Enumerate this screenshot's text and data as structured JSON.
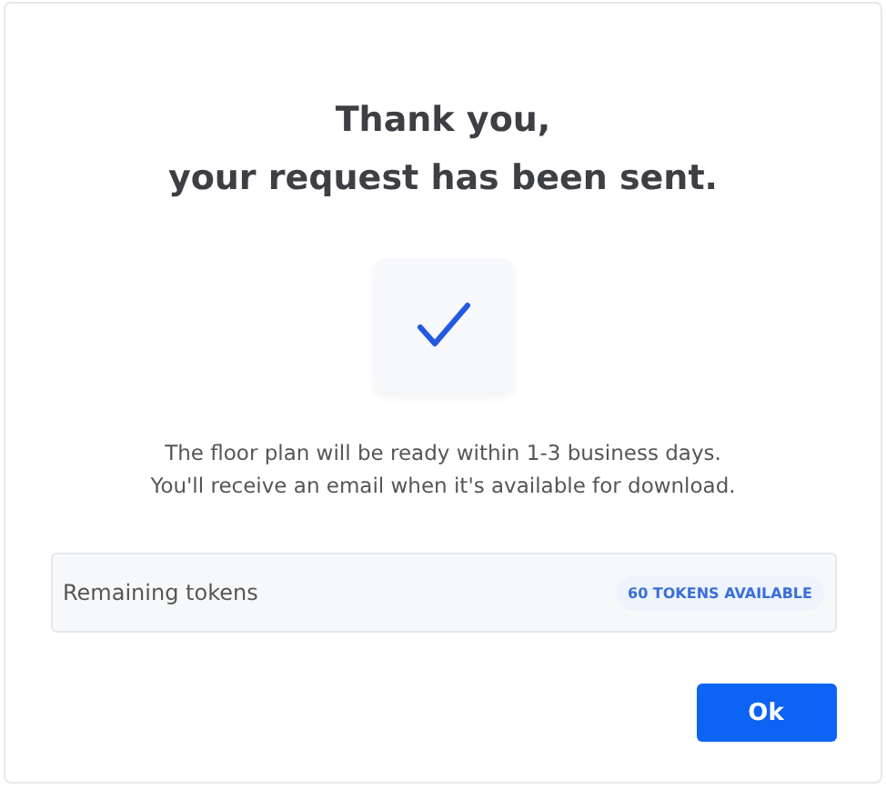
{
  "dialog": {
    "title": "Thank you,\nyour request has been sent.",
    "message": "The floor plan will be ready within 1-3 business days.\nYou'll receive an email when it's available for download.",
    "tokens": {
      "label": "Remaining tokens",
      "badge": "60 TOKENS AVAILABLE"
    },
    "buttons": [
      "Ok"
    ]
  }
}
